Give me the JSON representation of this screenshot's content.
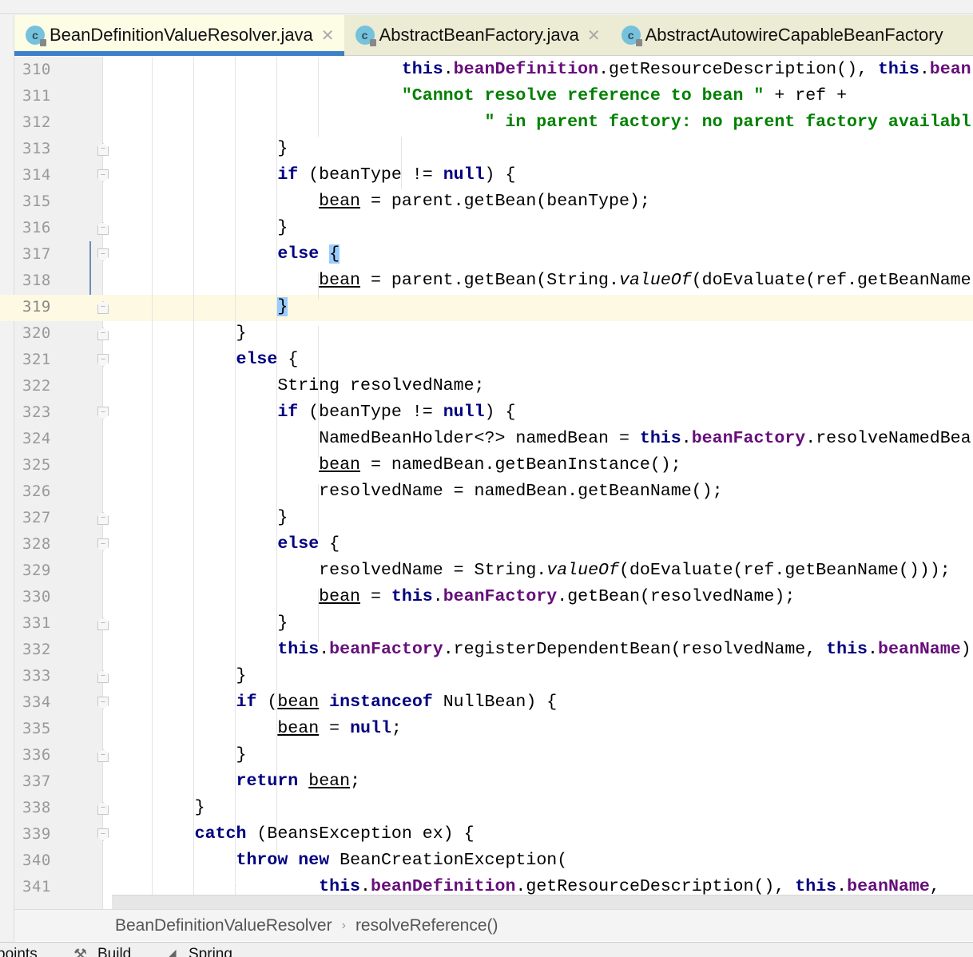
{
  "tabs": [
    {
      "label": "BeanDefinitionValueResolver.java",
      "active": true,
      "icon": "java-class-icon"
    },
    {
      "label": "AbstractBeanFactory.java",
      "active": false,
      "icon": "java-class-icon"
    },
    {
      "label": "AbstractAutowireCapableBeanFactory",
      "active": false,
      "icon": "java-class-icon"
    }
  ],
  "current_line": 319,
  "lines": [
    {
      "n": 310,
      "fold": "",
      "t": [
        [
          "                            ",
          ""
        ],
        [
          "this",
          "k"
        ],
        [
          ".",
          ""
        ],
        [
          "beanDefinition",
          "f"
        ],
        [
          ".getResourceDescription(), ",
          ""
        ],
        [
          "this",
          "k"
        ],
        [
          ".",
          ""
        ],
        [
          "bean",
          "f"
        ]
      ]
    },
    {
      "n": 311,
      "fold": "",
      "t": [
        [
          "                            ",
          ""
        ],
        [
          "\"Cannot resolve reference to bean \"",
          "s"
        ],
        [
          " + ref +",
          ""
        ]
      ]
    },
    {
      "n": 312,
      "fold": "",
      "t": [
        [
          "                                    ",
          ""
        ],
        [
          "\" in parent factory: no parent factory availabl",
          "s"
        ]
      ]
    },
    {
      "n": 313,
      "fold": "c",
      "t": [
        [
          "                }",
          ""
        ]
      ]
    },
    {
      "n": 314,
      "fold": "o",
      "t": [
        [
          "                ",
          ""
        ],
        [
          "if",
          "k"
        ],
        [
          " (beanType != ",
          ""
        ],
        [
          "null",
          "k"
        ],
        [
          ") {",
          ""
        ]
      ]
    },
    {
      "n": 315,
      "fold": "",
      "t": [
        [
          "                    ",
          ""
        ],
        [
          "bean",
          "u"
        ],
        [
          " = parent.getBean(beanType);",
          ""
        ]
      ]
    },
    {
      "n": 316,
      "fold": "c",
      "t": [
        [
          "                }",
          ""
        ]
      ]
    },
    {
      "n": 317,
      "fold": "o",
      "t": [
        [
          "                ",
          ""
        ],
        [
          "else",
          "k"
        ],
        [
          " ",
          ""
        ],
        [
          "{",
          "h"
        ]
      ]
    },
    {
      "n": 318,
      "fold": "",
      "t": [
        [
          "                    ",
          ""
        ],
        [
          "bean",
          "u"
        ],
        [
          " = parent.getBean(String.",
          ""
        ],
        [
          "valueOf",
          "i"
        ],
        [
          "(doEvaluate(ref.getBeanName",
          ""
        ]
      ]
    },
    {
      "n": 319,
      "fold": "c",
      "t": [
        [
          "                ",
          ""
        ],
        [
          "}",
          "h"
        ]
      ]
    },
    {
      "n": 320,
      "fold": "c",
      "t": [
        [
          "            }",
          ""
        ]
      ]
    },
    {
      "n": 321,
      "fold": "o",
      "t": [
        [
          "            ",
          ""
        ],
        [
          "else",
          "k"
        ],
        [
          " {",
          ""
        ]
      ]
    },
    {
      "n": 322,
      "fold": "",
      "t": [
        [
          "                String resolvedName;",
          ""
        ]
      ]
    },
    {
      "n": 323,
      "fold": "o",
      "t": [
        [
          "                ",
          ""
        ],
        [
          "if",
          "k"
        ],
        [
          " (beanType != ",
          ""
        ],
        [
          "null",
          "k"
        ],
        [
          ") {",
          ""
        ]
      ]
    },
    {
      "n": 324,
      "fold": "",
      "t": [
        [
          "                    NamedBeanHolder<?> namedBean = ",
          ""
        ],
        [
          "this",
          "k"
        ],
        [
          ".",
          ""
        ],
        [
          "beanFactory",
          "f"
        ],
        [
          ".resolveNamedBea",
          ""
        ]
      ]
    },
    {
      "n": 325,
      "fold": "",
      "t": [
        [
          "                    ",
          ""
        ],
        [
          "bean",
          "u"
        ],
        [
          " = namedBean.getBeanInstance();",
          ""
        ]
      ]
    },
    {
      "n": 326,
      "fold": "",
      "t": [
        [
          "                    resolvedName = namedBean.getBeanName();",
          ""
        ]
      ]
    },
    {
      "n": 327,
      "fold": "c",
      "t": [
        [
          "                }",
          ""
        ]
      ]
    },
    {
      "n": 328,
      "fold": "o",
      "t": [
        [
          "                ",
          ""
        ],
        [
          "else",
          "k"
        ],
        [
          " {",
          ""
        ]
      ]
    },
    {
      "n": 329,
      "fold": "",
      "t": [
        [
          "                    resolvedName = String.",
          ""
        ],
        [
          "valueOf",
          "i"
        ],
        [
          "(doEvaluate(ref.getBeanName()));",
          ""
        ]
      ]
    },
    {
      "n": 330,
      "fold": "",
      "t": [
        [
          "                    ",
          ""
        ],
        [
          "bean",
          "u"
        ],
        [
          " = ",
          ""
        ],
        [
          "this",
          "k"
        ],
        [
          ".",
          ""
        ],
        [
          "beanFactory",
          "f"
        ],
        [
          ".getBean(resolvedName);",
          ""
        ]
      ]
    },
    {
      "n": 331,
      "fold": "c",
      "t": [
        [
          "                }",
          ""
        ]
      ]
    },
    {
      "n": 332,
      "fold": "",
      "t": [
        [
          "                ",
          ""
        ],
        [
          "this",
          "k"
        ],
        [
          ".",
          ""
        ],
        [
          "beanFactory",
          "f"
        ],
        [
          ".registerDependentBean(resolvedName, ",
          ""
        ],
        [
          "this",
          "k"
        ],
        [
          ".",
          ""
        ],
        [
          "beanName",
          "f"
        ],
        [
          ")",
          ""
        ]
      ]
    },
    {
      "n": 333,
      "fold": "c",
      "t": [
        [
          "            }",
          ""
        ]
      ]
    },
    {
      "n": 334,
      "fold": "o",
      "t": [
        [
          "            ",
          ""
        ],
        [
          "if",
          "k"
        ],
        [
          " (",
          ""
        ],
        [
          "bean",
          "u"
        ],
        [
          " ",
          ""
        ],
        [
          "instanceof",
          "k"
        ],
        [
          " NullBean) {",
          ""
        ]
      ]
    },
    {
      "n": 335,
      "fold": "",
      "t": [
        [
          "                ",
          ""
        ],
        [
          "bean",
          "u"
        ],
        [
          " = ",
          ""
        ],
        [
          "null",
          "k"
        ],
        [
          ";",
          ""
        ]
      ]
    },
    {
      "n": 336,
      "fold": "c",
      "t": [
        [
          "            }",
          ""
        ]
      ]
    },
    {
      "n": 337,
      "fold": "",
      "t": [
        [
          "            ",
          ""
        ],
        [
          "return",
          "k"
        ],
        [
          " ",
          ""
        ],
        [
          "bean",
          "u"
        ],
        [
          ";",
          ""
        ]
      ]
    },
    {
      "n": 338,
      "fold": "c",
      "t": [
        [
          "        }",
          ""
        ]
      ]
    },
    {
      "n": 339,
      "fold": "o",
      "t": [
        [
          "        ",
          ""
        ],
        [
          "catch",
          "k"
        ],
        [
          " (BeansException ex) {",
          ""
        ]
      ]
    },
    {
      "n": 340,
      "fold": "",
      "t": [
        [
          "            ",
          ""
        ],
        [
          "throw",
          "k"
        ],
        [
          " ",
          ""
        ],
        [
          "new",
          "k"
        ],
        [
          " BeanCreationException(",
          ""
        ]
      ]
    },
    {
      "n": 341,
      "fold": "",
      "t": [
        [
          "                    ",
          ""
        ],
        [
          "this",
          "k"
        ],
        [
          ".",
          ""
        ],
        [
          "beanDefinition",
          "f"
        ],
        [
          ".getResourceDescription(), ",
          ""
        ],
        [
          "this",
          "k"
        ],
        [
          ".",
          ""
        ],
        [
          "beanName",
          "f"
        ],
        [
          ",",
          ""
        ]
      ]
    }
  ],
  "breadcrumb": [
    "BeanDefinitionValueResolver",
    "resolveReference()"
  ],
  "toolwindows": [
    "points",
    "Build",
    "Spring"
  ]
}
